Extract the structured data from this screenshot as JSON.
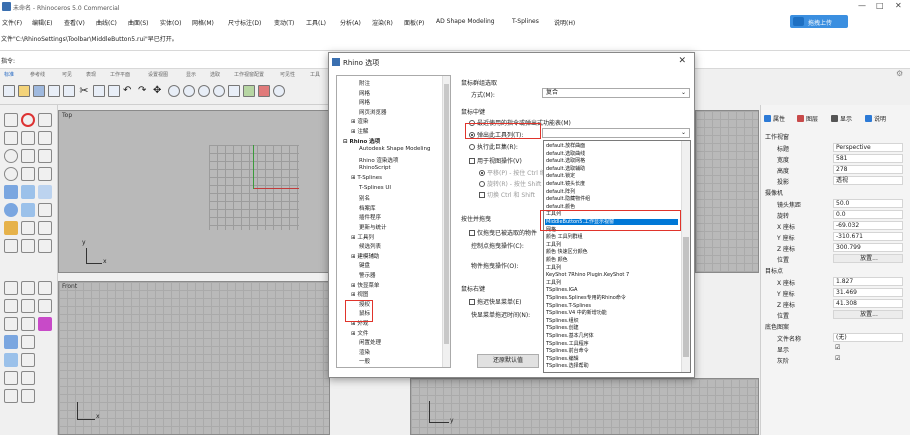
{
  "app": {
    "title": "未命名 - Rhinoceros 5.0 Commercial",
    "controls": [
      "—",
      "□",
      "✕"
    ]
  },
  "menu": [
    "文件(F)",
    "编辑(E)",
    "查看(V)",
    "曲线(C)",
    "曲面(S)",
    "实体(O)",
    "网格(M)",
    "尺寸标注(D)",
    "变动(T)",
    "工具(L)",
    "分析(A)",
    "渲染(R)",
    "面板(P)",
    "AD Shape Modeling",
    "T-Splines",
    "说明(H)"
  ],
  "login_button": "拖拽上传",
  "command_history": "文件\"C:\\RhinoSettings\\Toolbar\\MiddleButton5.rui\"早已打开。",
  "command_prompt": "指令:",
  "toolbar_tabs": [
    "标准",
    "参考线",
    "可见",
    "表现",
    "工作平面",
    "设置视图",
    "显示",
    "选取",
    "工作视窗配置",
    "可见性",
    "工具"
  ],
  "viewports": {
    "top": "Top",
    "front": "Front",
    "axis_x": "x",
    "axis_y": "y"
  },
  "properties_panel": {
    "tabs": [
      "属性",
      "图层",
      "显示",
      "说明"
    ],
    "sections": {
      "viewport": "工作视窗",
      "camera": "摄像机",
      "target": "目标点",
      "wallpaper": "底色图案"
    },
    "rows": {
      "title": {
        "label": "标题",
        "value": "Perspective"
      },
      "width": {
        "label": "宽度",
        "value": "581"
      },
      "height": {
        "label": "高度",
        "value": "278"
      },
      "projection": {
        "label": "投影",
        "value": "透视"
      },
      "lens": {
        "label": "镜头焦距",
        "value": "50.0"
      },
      "rotation": {
        "label": "旋转",
        "value": "0.0"
      },
      "cx": {
        "label": "X 座标",
        "value": "-69.032"
      },
      "cy": {
        "label": "Y 座标",
        "value": "-310.671"
      },
      "cz": {
        "label": "Z 座标",
        "value": "300.799"
      },
      "cam_pos": {
        "label": "位置",
        "value": "放置..."
      },
      "tx": {
        "label": "X 座标",
        "value": "1.827"
      },
      "ty": {
        "label": "Y 座标",
        "value": "31.469"
      },
      "tz": {
        "label": "Z 座标",
        "value": "41.308"
      },
      "tgt_pos": {
        "label": "位置",
        "value": "放置..."
      },
      "filename": {
        "label": "文件名称",
        "value": "(无)"
      },
      "show": {
        "label": "显示",
        "value": "☑"
      },
      "grayscale": {
        "label": "灰阶",
        "value": "☑"
      }
    }
  },
  "dialog": {
    "title": "Rhino 选项",
    "tree": [
      "附注",
      "网格",
      "网格",
      "网页浏览器",
      "渲染",
      "注解",
      "Rhino 选项",
      "Autodesk Shape Modeling",
      "Rhino 渲染选项",
      "RhinoScript",
      "T-Splines",
      "T-Splines UI",
      "别名",
      "档案库",
      "插件程序",
      "更新与统计",
      "工具列",
      "候选列表",
      "建模辅助",
      "键盘",
      "警示器",
      "快显菜单",
      "视图",
      "授权",
      "鼠标",
      "外观",
      "文件",
      "闲置处理",
      "渲染",
      "一般"
    ],
    "group_mouse_click": "鼠标群组选取",
    "method_label": "方式(M):",
    "method_value": "复合",
    "middle_button": "鼠标中键",
    "opt_popup_menu": "最近使用的指令或弹出式功能表(M)",
    "opt_popup_toolbar": "弹出此工具列(T):",
    "opt_run_macro": "执行此巨集(R):",
    "opt_pan": "用于视图操作(V)",
    "sub_pan": "平移(P) - 按住 Ctrl 缩放",
    "sub_rotate": "旋转(R) - 按住 Shift 平移",
    "sub_ctrl_shift": "切换 Ctrl 和 Shift",
    "drag_label": "按住并拖曳",
    "chk_only_highlight": "仅拖曳已被选取的物件",
    "ctrl_drag_label": "控制点拖曳操作(C):",
    "obj_drag_label": "物件拖曳操作(O):",
    "right_button": "鼠标右键",
    "chk_delay_menu": "拖迟快显菜单(E)",
    "delay_time": "快显菜单拖迟时间(N):",
    "btn_restore": "还原默认值",
    "dropdown": [
      "default.放样曲面",
      "default.选取曲线",
      "default.选取网格",
      "default.选取辅助",
      "default.锁定",
      "default.镜头长度",
      "default.阵列",
      "default.隐藏物件组",
      "default.颜色",
      "工具列",
      "MiddleButton5.工作显示视窗",
      "网格",
      "颜色 工具列群组",
      "工具列",
      "颜色 快速区分颜色",
      "颜色 颜色",
      "工具列",
      "KeyShot 7Rhino Plugin.KeyShot 7",
      "工具列",
      "TSplines.IGA",
      "TSplines.Splines专用的Rhino命令",
      "TSplines.T-Splines",
      "TSplines.V4 中的新增功能",
      "TSplines.组织",
      "TSplines.创建",
      "TSplines.基本几何体",
      "TSplines.工具程序",
      "TSplines.前台命令",
      "TSplines.编辑",
      "TSplines.选择帮助"
    ],
    "dropdown_selected_index": 10
  }
}
